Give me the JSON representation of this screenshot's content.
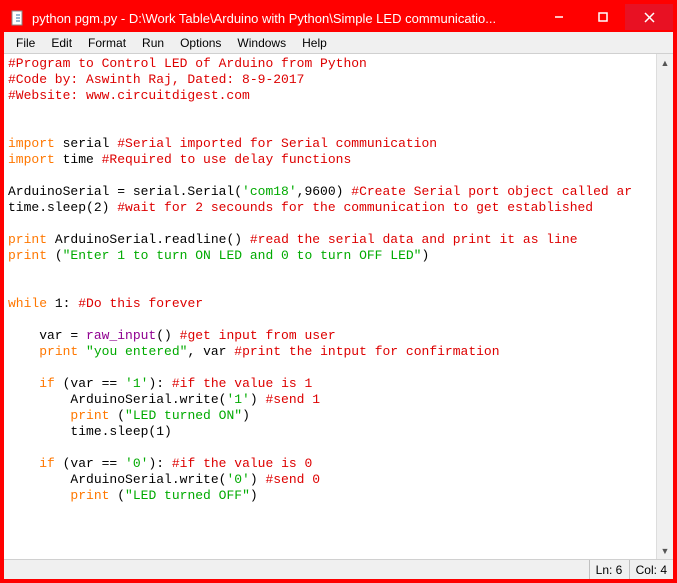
{
  "window": {
    "title": "python pgm.py - D:\\Work Table\\Arduino with Python\\Simple LED communicatio...",
    "icon_name": "python-file-icon"
  },
  "menus": [
    "File",
    "Edit",
    "Format",
    "Run",
    "Options",
    "Windows",
    "Help"
  ],
  "status": {
    "line": "Ln: 6",
    "col": "Col: 4"
  },
  "code": {
    "l1_c": "#Program to Control LED of Arduino from Python",
    "l2_c": "#Code by: Aswinth Raj, Dated: 8-9-2017",
    "l3_c": "#Website: www.circuitdigest.com",
    "l4_kw": "import",
    "l4_txt": " serial ",
    "l4_c": "#Serial imported for Serial communication",
    "l5_kw": "import",
    "l5_txt": " time ",
    "l5_c": "#Required to use delay functions",
    "l6_txt": "ArduinoSerial = serial.Serial(",
    "l6_str": "'com18'",
    "l6_txt2": ",9600) ",
    "l6_c": "#Create Serial port object called ar",
    "l7_txt": "time.sleep(2) ",
    "l7_c": "#wait for 2 secounds for the communication to get established",
    "l8_kw": "print",
    "l8_txt": " ArduinoSerial.readline() ",
    "l8_c": "#read the serial data and print it as line",
    "l9_kw": "print",
    "l9_txt": " (",
    "l9_str": "\"Enter 1 to turn ON LED and 0 to turn OFF LED\"",
    "l9_txt2": ")",
    "l10_kw": "while",
    "l10_txt": " 1: ",
    "l10_c": "#Do this forever",
    "l11_txt": "    var = ",
    "l11_fn": "raw_input",
    "l11_txt2": "() ",
    "l11_c": "#get input from user",
    "l12_ind": "    ",
    "l12_kw": "print",
    "l12_sp": " ",
    "l12_str": "\"you entered\"",
    "l12_txt": ", var ",
    "l12_c": "#print the intput for confirmation",
    "l13_ind": "    ",
    "l13_kw": "if",
    "l13_txt": " (var == ",
    "l13_str": "'1'",
    "l13_txt2": "): ",
    "l13_c": "#if the value is 1",
    "l14_txt": "        ArduinoSerial.write(",
    "l14_str": "'1'",
    "l14_txt2": ") ",
    "l14_c": "#send 1",
    "l15_ind": "        ",
    "l15_kw": "print",
    "l15_txt": " (",
    "l15_str": "\"LED turned ON\"",
    "l15_txt2": ")",
    "l16_txt": "        time.sleep(1)",
    "l17_ind": "    ",
    "l17_kw": "if",
    "l17_txt": " (var == ",
    "l17_str": "'0'",
    "l17_txt2": "): ",
    "l17_c": "#if the value is 0",
    "l18_txt": "        ArduinoSerial.write(",
    "l18_str": "'0'",
    "l18_txt2": ") ",
    "l18_c": "#send 0",
    "l19_ind": "        ",
    "l19_kw": "print",
    "l19_txt": " (",
    "l19_str": "\"LED turned OFF\"",
    "l19_txt2": ")"
  }
}
